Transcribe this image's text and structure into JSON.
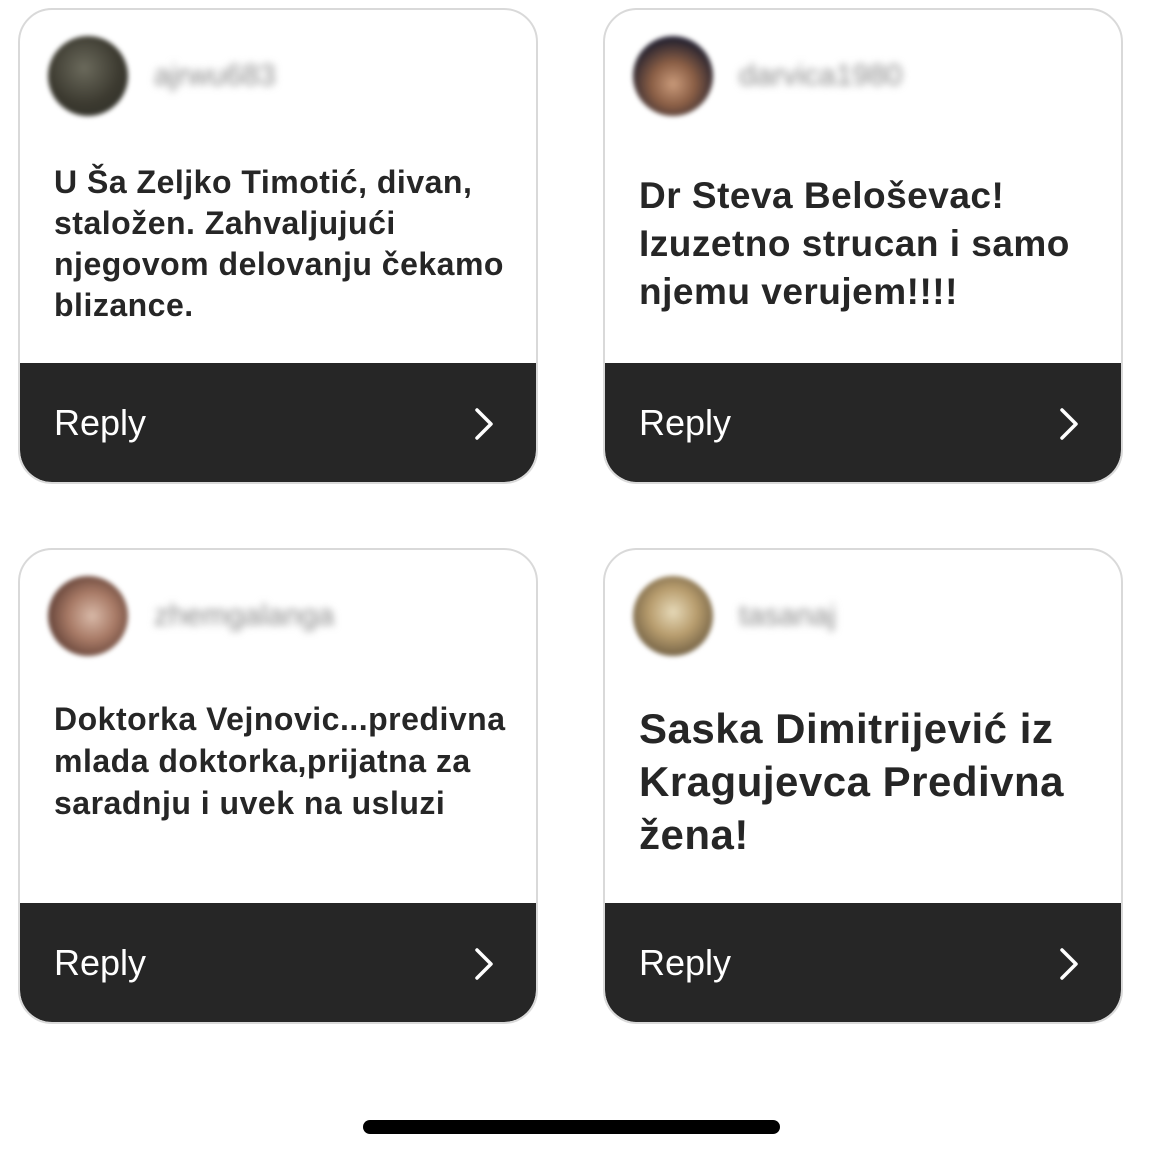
{
  "cards": [
    {
      "username": "ajrwu683",
      "text": "U Ša Zeljko Timotić, divan, staložen. Zahvaljujući njegovom delovanju čekamo blizance.",
      "reply_label": "Reply"
    },
    {
      "username": "darvica1980",
      "text": "Dr Steva Beloševac! Izuzetno strucan i samo njemu verujem!!!!",
      "reply_label": "Reply"
    },
    {
      "username": "zhemgalanga",
      "text": "Doktorka Vejnovic...predivna mlada doktorka,prijatna za saradnju i uvek na usluzi",
      "reply_label": "Reply"
    },
    {
      "username": "tasanaj",
      "text": "Saska Dimitrijević iz Kragujevca Predivna žena!",
      "reply_label": "Reply"
    }
  ],
  "icons": {
    "reply_arrow": "chevron-right-icon"
  }
}
